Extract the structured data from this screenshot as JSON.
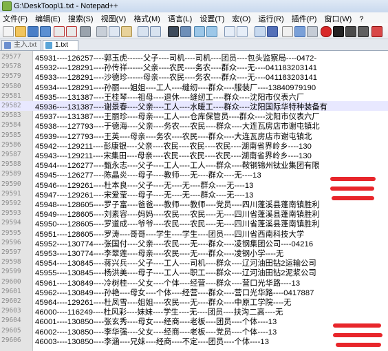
{
  "window": {
    "title": "G:\\DeskToop\\1.txt - Notepad++"
  },
  "menu": [
    "文件(F)",
    "编辑(E)",
    "搜索(S)",
    "视图(V)",
    "格式(M)",
    "语言(L)",
    "设置(T)",
    "宏(O)",
    "运行(R)",
    "插件(P)",
    "窗口(W)",
    "?"
  ],
  "toolbar_icons": [
    "new-file-icon",
    "open-file-icon",
    "save-icon",
    "save-all-icon",
    "close-icon",
    "close-all-icon",
    "print-icon",
    "cut-icon",
    "copy-icon",
    "paste-icon",
    "undo-icon",
    "redo-icon",
    "find-icon",
    "replace-icon",
    "zoom-in-icon",
    "zoom-out-icon",
    "sync-v-icon",
    "sync-h-icon",
    "wrap-icon",
    "all-chars-icon",
    "indent-guide-icon",
    "udl-icon",
    "doc-map-icon",
    "record-macro-icon",
    "stop-macro-icon",
    "play-macro-icon",
    "run-macro-multiple-icon",
    "save-macro-icon"
  ],
  "tabs": [
    {
      "label": "主入.txt",
      "active": false
    },
    {
      "label": "1.txt",
      "active": true
    }
  ],
  "lines": [
    {
      "n": "29577",
      "text": "45931----126257----郭玉虎------父子----司机----司机----团员----包头监察局----0472-"
    },
    {
      "n": "29578",
      "text": "45932----128291----孙传祥------父亲----农民----务农----群众----无----041183203141"
    },
    {
      "n": "29579",
      "text": "45933----128291----沙德珍------母亲----农民----务农----群众----无----041183203141"
    },
    {
      "n": "29580",
      "text": "45934----128291----孙丽----姐姐----工人----缝纫----群众----服装厂----13840979190"
    },
    {
      "n": "29581",
      "text": "45935----131387----王桂琴----祖母----退休----缝纫工----群众----沈阳市仪表六厂"
    },
    {
      "n": "29582",
      "text": "45936----131387----谢景春----父亲----工人----水暖工----群众----沈阳国际华特种装备有"
    },
    {
      "n": "29583",
      "text": "45937----131387----王丽珍----母亲----工人----仓库保管员----群众----沈阳市仪表六厂"
    },
    {
      "n": "29584",
      "text": "45938----127793----于德海----父亲----务农----农民----群众----大连瓦房店市谢屯镇北"
    },
    {
      "n": "29585",
      "text": "45939----127793----王英----母亲----务农----农民----群众----大连瓦房店市谢屯镇北"
    },
    {
      "n": "29586",
      "text": "45942----129211----彭康银----父亲----农民----农民----农民----湖南省界岭乡----130"
    },
    {
      "n": "29587",
      "text": "45943----129211----宋集田----母亲----农民----农民----农民----湖南省界岭乡----130"
    },
    {
      "n": "29588",
      "text": "45944----126277----甄永志----父子----工人----工人----群众----鞍钢锦州钛业集团有限"
    },
    {
      "n": "29589",
      "text": "45945----126277----陈晶炎----母子----教师----无----群众----无----13"
    },
    {
      "n": "29590",
      "text": "45946----129261----杜本良----父子----无----无----群众----无----13"
    },
    {
      "n": "29591",
      "text": "45947----129261----宋爱莹----母子----无----无----群众----无----13"
    },
    {
      "n": "29592",
      "text": "45948----128605----罗子富----爸爸----教师----教师----党员----四川蓬溪县蓬南镇胜利"
    },
    {
      "n": "29593",
      "text": "45949----128605----刘素容----妈妈----农民----农民----无----四川省蓬溪县蓬南镇胜利"
    },
    {
      "n": "29594",
      "text": "45950----128605----罗道成----爷爷----农民----农民----无----四川省蓬溪县蓬南镇胜利"
    },
    {
      "n": "29595",
      "text": "45951----128605----罗涛----哥哥----学生----学生----团员----四川省西南科技大学"
    },
    {
      "n": "29596",
      "text": "45952----130774----张国付----父亲----农民----无----群众----凌钢集团公司----04216"
    },
    {
      "n": "29597",
      "text": "45953----130774----李翠莲----母亲----农民----无----群众----凌钢小学----无"
    },
    {
      "n": "29598",
      "text": "45954----130845----蒋兴兵----父子----工人----司机----群众----辽河油田钻2运输公司"
    },
    {
      "n": "29599",
      "text": "45955----130845----杨洪美----母子----工人----职工----群众----辽河油田钻2泥浆公司"
    },
    {
      "n": "29600",
      "text": "45961----130849----冷树桂----父女----个体----经营----群众----营口光华路----13"
    },
    {
      "n": "29601",
      "text": "45962----130849----孙艳----母女----个体----经营----群众----营口光华路----0417887"
    },
    {
      "n": "29602",
      "text": "45964----129261----杜凤雪----姐姐----农民----无----群众----中原工学院----无"
    },
    {
      "n": "29603",
      "text": "46000----116249----杜风彩----妹妹----学生----无----团员----扶沟二高----无"
    },
    {
      "n": "29604",
      "text": "46001----130850----张玄秀----母女----经商----老板----团员----个体----13"
    },
    {
      "n": "29605",
      "text": "46002----130850----李华强----父女----经商----老板----党员----个体----13"
    },
    {
      "n": "29606",
      "text": "46003----130850----李涵----兄妹----经商----不定----团员----个体----13"
    }
  ]
}
